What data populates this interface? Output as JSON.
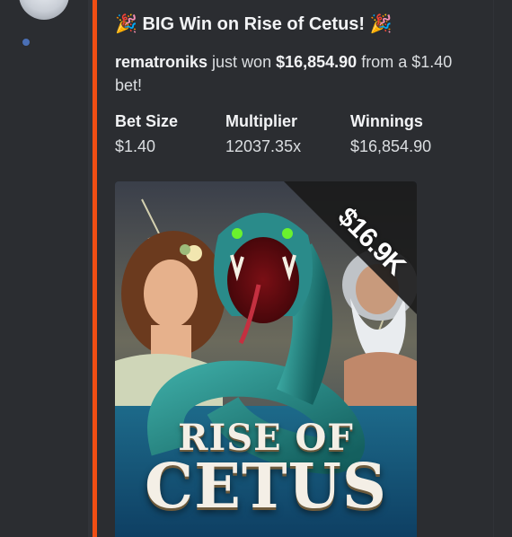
{
  "embed": {
    "title_emoji": "🎉",
    "title": "BIG Win on Rise of Cetus!",
    "description": {
      "username": "rematroniks",
      "text_before_amount": " just won ",
      "amount": "$16,854.90",
      "text_after_amount": " from a $1.40 bet!"
    },
    "fields": [
      {
        "name": "Bet Size",
        "value": "$1.40"
      },
      {
        "name": "Multiplier",
        "value": "12037.35x"
      },
      {
        "name": "Winnings",
        "value": "$16,854.90"
      }
    ],
    "accent_color": "#f04e14"
  },
  "game_image": {
    "ribbon_text": "$16.9K",
    "title_line1": "RISE OF",
    "title_line2": "CETUS"
  }
}
